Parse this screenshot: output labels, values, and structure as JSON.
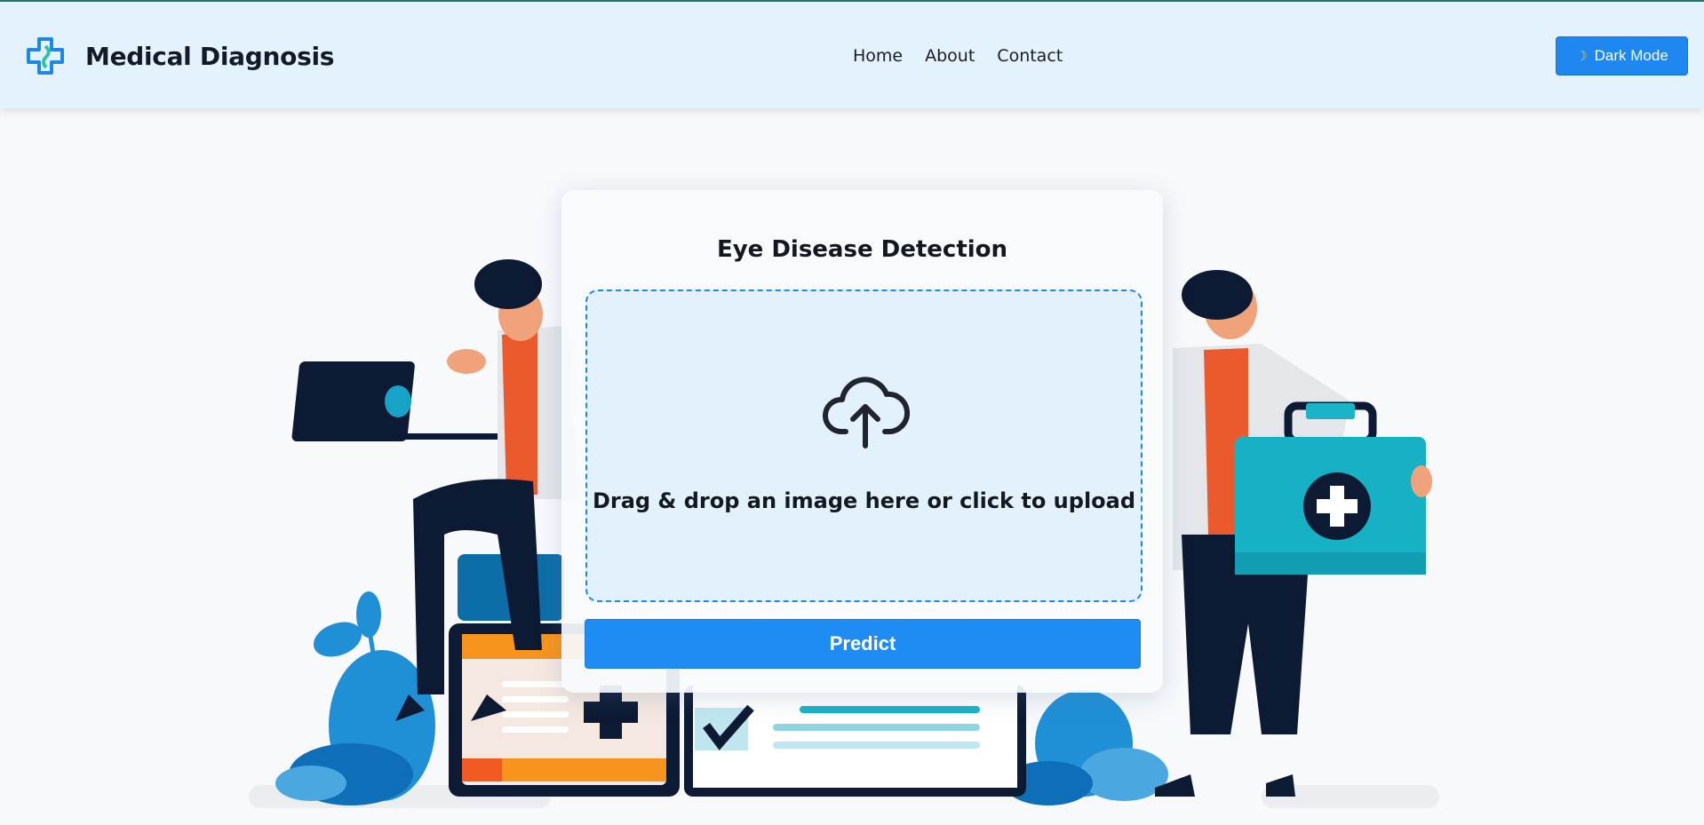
{
  "header": {
    "brand_title": "Medical Diagnosis",
    "nav": [
      "Home",
      "About",
      "Contact"
    ],
    "dark_mode_label": "Dark Mode",
    "dark_mode_icon": "moon-icon"
  },
  "card": {
    "title": "Eye Disease Detection",
    "dropzone_text": "Drag & drop an image here or click to upload",
    "upload_icon": "cloud-upload-icon",
    "predict_label": "Predict"
  },
  "colors": {
    "header_bg": "#e3f2fd",
    "accent": "#1e88f0",
    "dropzone_bg": "#e3f1fc"
  }
}
